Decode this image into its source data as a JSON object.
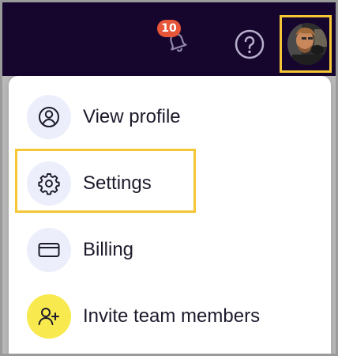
{
  "topbar": {
    "notifications": {
      "count": "10",
      "icon": "bell-icon",
      "badge_color": "#e8563a"
    },
    "help": {
      "icon": "question-circle-icon"
    },
    "avatar": {
      "icon": "user-avatar-photo"
    },
    "background_color": "#16062e",
    "highlight_color": "#f5c635"
  },
  "menu": {
    "items": [
      {
        "label": "View profile",
        "icon": "user-circle-icon"
      },
      {
        "label": "Settings",
        "icon": "gear-icon"
      },
      {
        "label": "Billing",
        "icon": "credit-card-icon"
      },
      {
        "label": "Invite team members",
        "icon": "user-plus-icon"
      }
    ]
  }
}
